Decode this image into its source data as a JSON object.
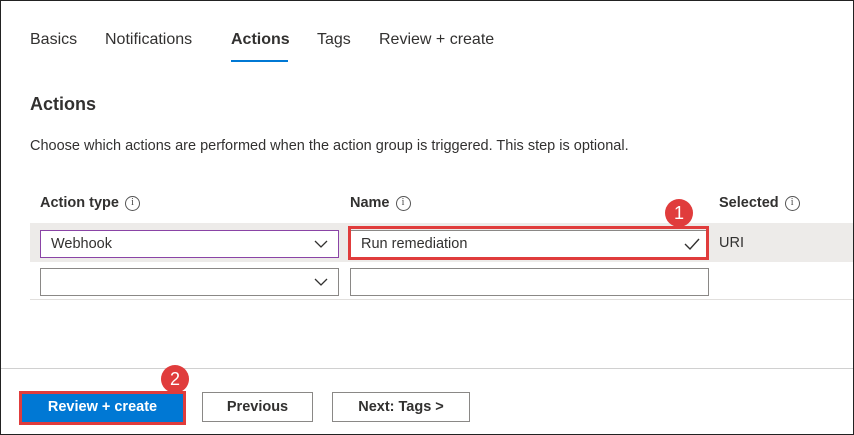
{
  "tabs": [
    {
      "label": "Basics",
      "active": false
    },
    {
      "label": "Notifications",
      "active": false
    },
    {
      "label": "Actions",
      "active": true
    },
    {
      "label": "Tags",
      "active": false
    },
    {
      "label": "Review + create",
      "active": false
    }
  ],
  "section": {
    "title": "Actions",
    "description": "Choose which actions are performed when the action group is triggered. This step is optional."
  },
  "table": {
    "columns": [
      "Action type",
      "Name",
      "Selected"
    ],
    "info_icon": "info-icon",
    "rows": [
      {
        "action_type": "Webhook",
        "name": "Run remediation",
        "selected": "URI"
      },
      {
        "action_type": "",
        "name": "",
        "selected": ""
      }
    ]
  },
  "annotations": {
    "badge1": "1",
    "badge2": "2",
    "highlight_color": "#e03c3c"
  },
  "footer": {
    "review_create": "Review + create",
    "previous": "Previous",
    "next": "Next: Tags >"
  },
  "colors": {
    "accent": "#0078d4",
    "row_highlight": "#edebe9"
  }
}
